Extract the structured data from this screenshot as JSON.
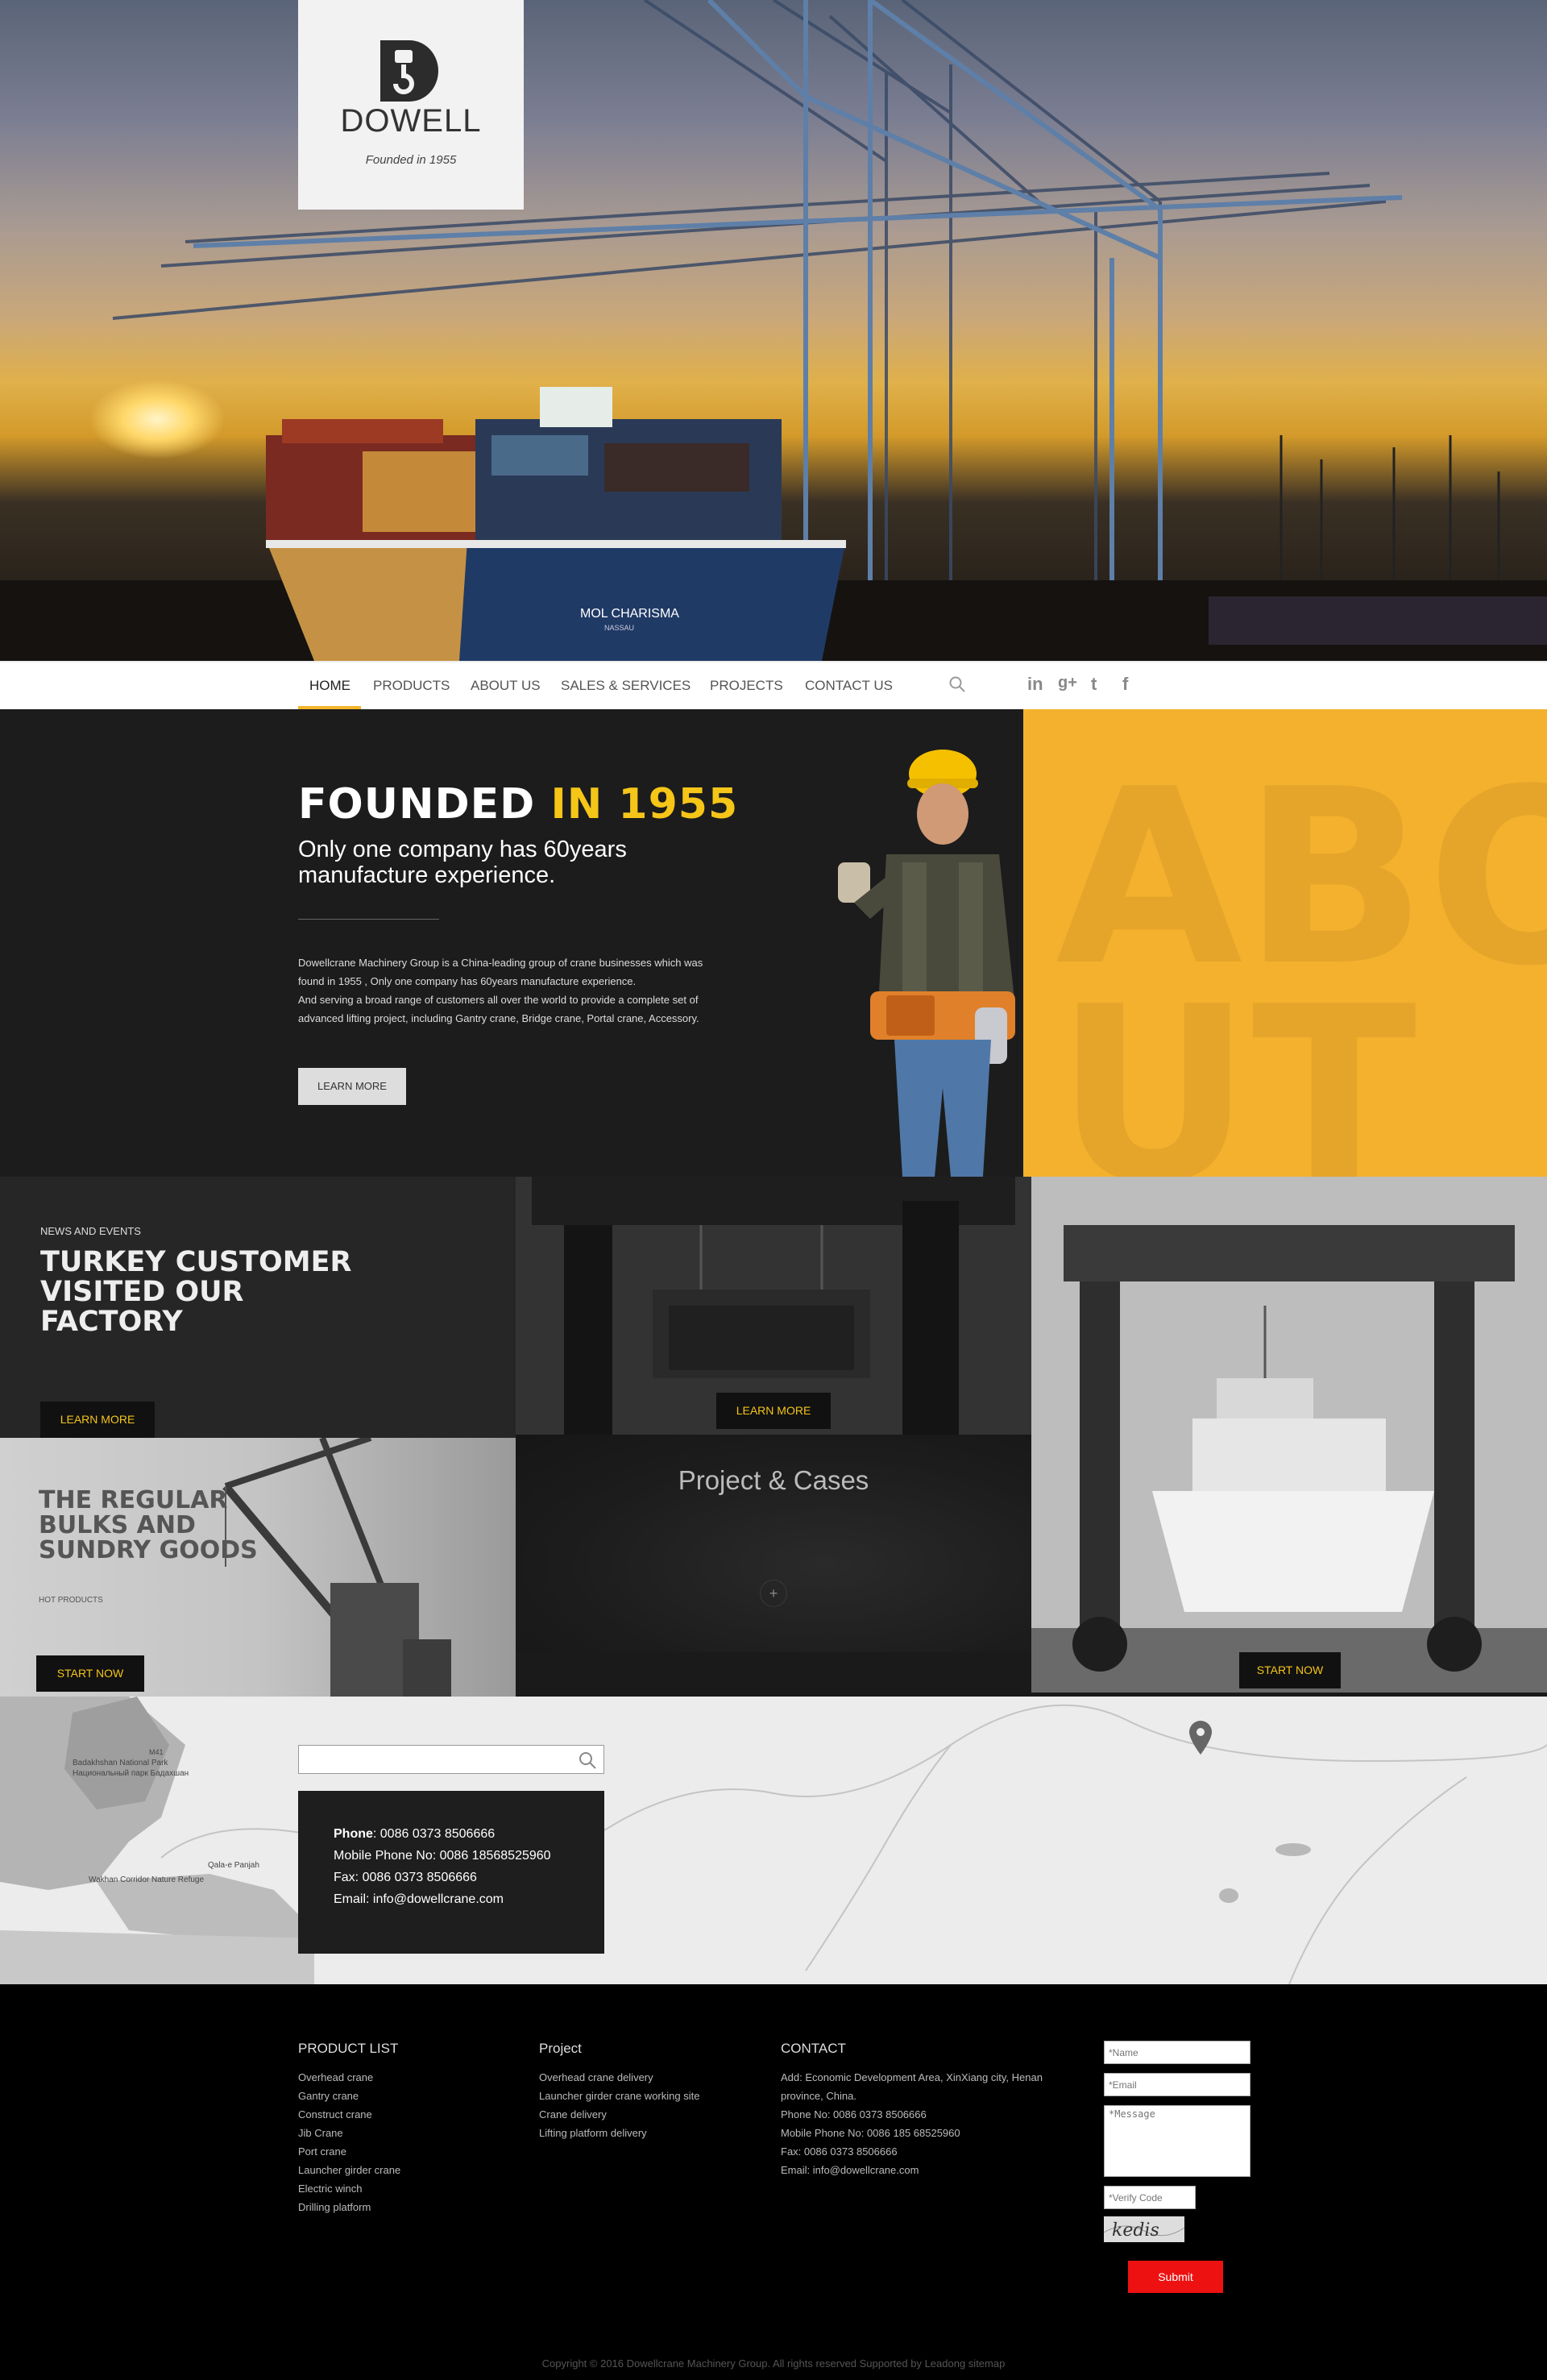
{
  "brand": {
    "name": "DOWELL",
    "tagline": "Founded in 1955"
  },
  "hero": {
    "ship_name": "MOL CHARISMA",
    "ship_port": "NASSAU"
  },
  "nav": {
    "items": [
      "HOME",
      "PRODUCTS",
      "ABOUT US",
      "SALES & SERVICES",
      "PROJECTS",
      "CONTACT US"
    ],
    "active": "HOME",
    "search_icon": "search-icon",
    "social": [
      "linkedin-icon",
      "google-plus-icon",
      "twitter-icon",
      "facebook-icon"
    ],
    "social_glyphs": [
      "in",
      "g+",
      "t",
      "f"
    ]
  },
  "about": {
    "title_white": "FOUNDED",
    "title_yellow": "IN 1955",
    "subtitle": "Only one company has 60years manufacture experience.",
    "body_lines": [
      "Dowellcrane Machinery Group is a China-leading group of crane businesses which was",
      "found in 1955 , Only one company has 60years manufacture experience.",
      "And serving a broad range of customers all over the world to provide a complete set of",
      "advanced lifting project, including Gantry crane, Bridge crane, Portal crane, Accessory."
    ],
    "button": "LEARN MORE",
    "watermark_top": "ABO",
    "watermark_bottom": "UT",
    "accent_color": "#f3b12d"
  },
  "news": {
    "label": "NEWS AND EVENTS",
    "title": "TURKEY CUSTOMER VISITED OUR FACTORY",
    "button": "LEARN MORE"
  },
  "crane_tile": {
    "button": "LEARN MORE"
  },
  "boat_tile": {
    "button": "START NOW"
  },
  "bulk": {
    "title": "THE REGULAR BULKS AND SUNDRY GOODS",
    "subtitle": "HOT PRODUCTS",
    "button": "START NOW"
  },
  "cases": {
    "title": "Project & Cases",
    "plus": "+"
  },
  "map": {
    "search_placeholder": "",
    "labels": [
      "Badakhshan National Park",
      "Национальный парк Бадахшан",
      "Wakhan Corridor Nature Refuge",
      "Qala-e Panjah",
      "M41"
    ]
  },
  "contact_box": {
    "phone_label": "Phone",
    "phone": ": 0086 0373 8506666",
    "mobile": "Mobile Phone No: 0086 18568525960",
    "fax": "Fax: 0086 0373 8506666",
    "email": "Email: info@dowellcrane.com"
  },
  "footer": {
    "product_list": {
      "heading": "PRODUCT LIST",
      "items": [
        "Overhead crane",
        "Gantry crane",
        "Construct crane",
        "Jib Crane",
        "Port crane",
        "Launcher girder crane",
        "Electric winch",
        "Drilling platform"
      ]
    },
    "project": {
      "heading": "Project",
      "items": [
        "Overhead crane delivery",
        "Launcher girder crane working site",
        "Crane delivery",
        "Lifting platform delivery"
      ]
    },
    "contact": {
      "heading": "CONTACT",
      "items": [
        "Add: Economic Development Area, XinXiang city, Henan",
        "province, China.",
        "Phone No: 0086 0373 8506666",
        "Mobile Phone No: 0086 185 68525960",
        "Fax: 0086 0373 8506666",
        "Email: info@dowellcrane.com"
      ]
    },
    "form": {
      "name_placeholder": "*Name",
      "email_placeholder": "*Email",
      "message_placeholder": "*Message",
      "verify_placeholder": "*Verify Code",
      "captcha_text": "kedis",
      "submit": "Submit"
    },
    "copyright": "Copyright © 2016 Dowellcrane Machinery Group. All rights reserved   Supported by Leadong   sitemap"
  }
}
